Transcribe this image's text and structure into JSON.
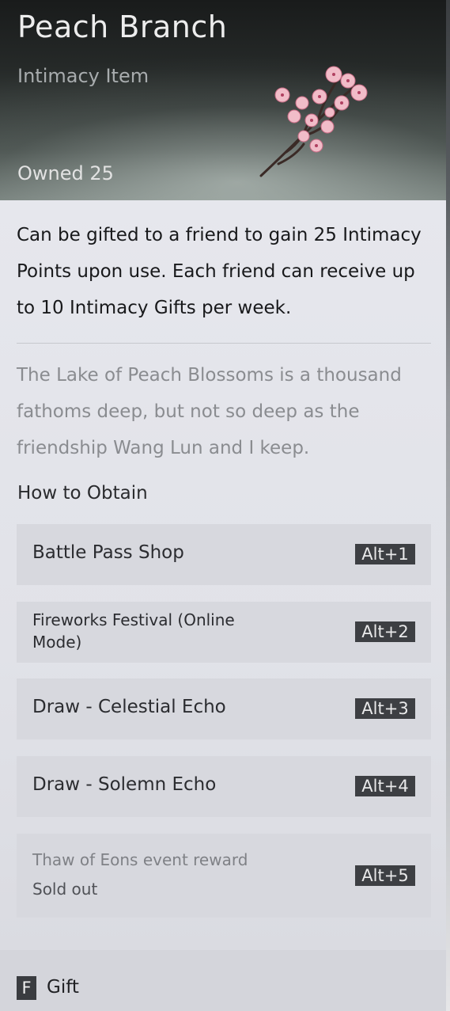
{
  "item": {
    "name": "Peach Branch",
    "category": "Intimacy Item",
    "owned": "Owned 25"
  },
  "description": "Can be gifted to a friend to gain 25 Intimacy Points upon use. Each friend can receive up to 10 Intimacy Gifts per week.",
  "flavor": "The Lake of Peach Blossoms is a thousand fathoms deep, but not so deep as the friendship Wang Lun and I keep.",
  "obtain": {
    "heading": "How to Obtain",
    "sources": [
      {
        "label": "Battle Pass Shop",
        "key": "Alt+1"
      },
      {
        "label": "Fireworks Festival (Online Mode)",
        "key": "Alt+2"
      },
      {
        "label": "Draw - Celestial Echo",
        "key": "Alt+3"
      },
      {
        "label": "Draw - Solemn Echo",
        "key": "Alt+4"
      },
      {
        "label": "Thaw of Eons event reward",
        "status": "Sold out",
        "key": "Alt+5"
      }
    ]
  },
  "footer": {
    "key": "F",
    "label": "Gift"
  },
  "icons": [
    "peach-branch-icon"
  ],
  "colors": {
    "panel": "#e4e5eb",
    "source_row": "#d7d8de",
    "key_badge": "#3d3f43",
    "header_dark": "#1b1d1d"
  }
}
